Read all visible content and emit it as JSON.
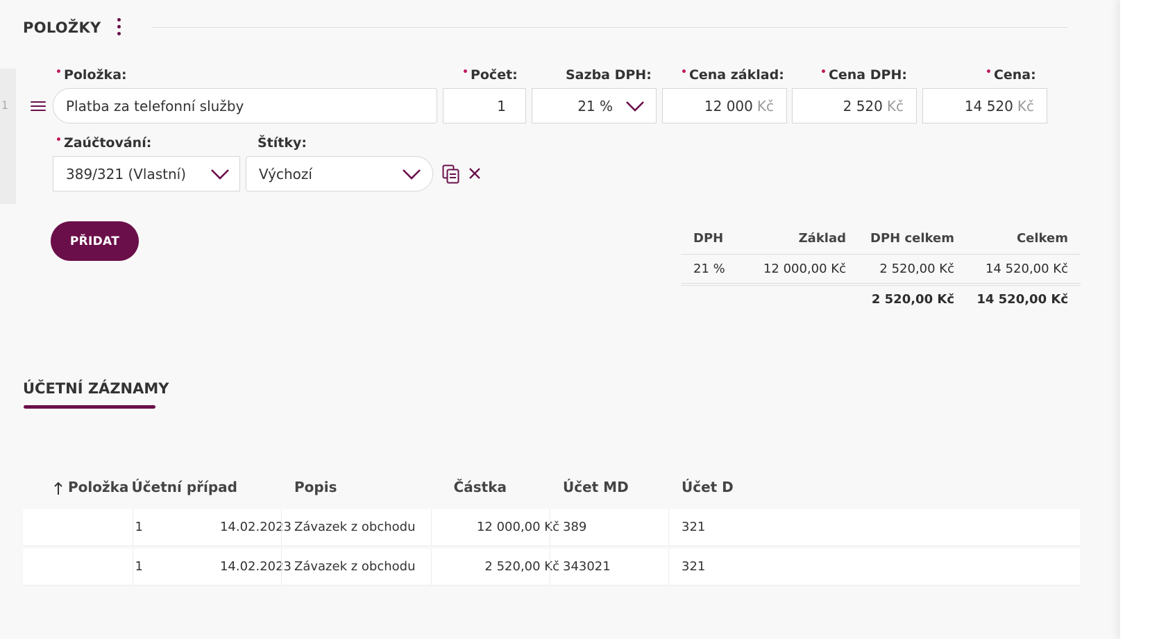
{
  "section": {
    "title": "POLOŽKY",
    "menu_icon": "kebab-menu-icon"
  },
  "item": {
    "row_number": "1",
    "fields": {
      "polozka": {
        "label": "Položka:",
        "value": "Platba za telefonní služby",
        "required": true
      },
      "pocet": {
        "label": "Počet:",
        "value": "1",
        "required": true
      },
      "sazba_dph": {
        "label": "Sazba DPH:",
        "value": "21 %"
      },
      "cena_zaklad": {
        "label": "Cena základ:",
        "value": "12 000",
        "unit": "Kč",
        "required": true
      },
      "cena_dph": {
        "label": "Cena DPH:",
        "value": "2 520",
        "unit": "Kč",
        "required": true
      },
      "cena": {
        "label": "Cena:",
        "value": "14 520",
        "unit": "Kč",
        "required": true
      },
      "zauctovani": {
        "label": "Zaúčtování:",
        "value": "389/321 (Vlastní)",
        "required": true
      },
      "stitky": {
        "label": "Štítky:",
        "value": "Výchozí"
      }
    },
    "required_marker": "•",
    "actions": {
      "copy_icon": "copy-icon",
      "remove_icon": "close-icon"
    }
  },
  "add_button": {
    "label": "PŘIDAT"
  },
  "vat_summary": {
    "columns": [
      "DPH",
      "Základ",
      "DPH celkem",
      "Celkem"
    ],
    "rows": [
      [
        "21 %",
        "12 000,00 Kč",
        "2 520,00 Kč",
        "14 520,00 Kč"
      ]
    ],
    "totals": {
      "dph_celkem": "2 520,00 Kč",
      "celkem": "14 520,00 Kč"
    }
  },
  "accounting": {
    "tab_title": "ÚČETNÍ ZÁZNAMY",
    "sort_icon": "arrow-up-icon",
    "columns": [
      "Položka",
      "Účetní případ",
      "Popis",
      "Částka",
      "Účet MD",
      "Účet D"
    ],
    "rows": [
      [
        "1",
        "14.02.2023",
        "Závazek z obchodu",
        "12 000,00 Kč",
        "389",
        "321"
      ],
      [
        "1",
        "14.02.2023",
        "Závazek z obchodu",
        "2 520,00 Kč",
        "343021",
        "321"
      ]
    ]
  },
  "colors": {
    "accent": "#6b0f4a",
    "required": "#c2185b",
    "background": "#f8f8f8"
  }
}
